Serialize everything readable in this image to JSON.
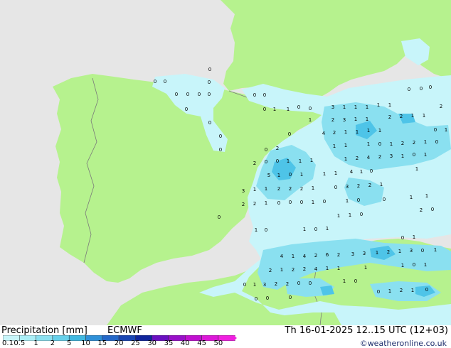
{
  "footer": {
    "title": "Precipitation [mm]",
    "model": "ECMWF",
    "datetime": "Th 16-01-2025 12..15 UTC (12+03)",
    "credit": "©weatheronline.co.uk"
  },
  "legend": {
    "labels": [
      "0.1",
      "0.5",
      "1",
      "2",
      "5",
      "10",
      "15",
      "20",
      "25",
      "30",
      "35",
      "40",
      "45",
      "50"
    ],
    "colors": [
      "#c8f5fa",
      "#aaeef6",
      "#8ae0f0",
      "#66d0ea",
      "#40b8e0",
      "#2f90d8",
      "#2468c8",
      "#1a46b4",
      "#10249c",
      "#6a10c0",
      "#9810c8",
      "#c010d0",
      "#dc18d8",
      "#f020e0"
    ]
  },
  "map": {
    "colors": {
      "land": "#b6f28e",
      "sea": "#e6e6e6",
      "precip_light": "#c8f5fa",
      "precip_mid": "#8ae0f0",
      "precip_heavy": "#4ec4e8",
      "border": "#7a7a7a"
    },
    "values": [
      {
        "id": "v1",
        "t": "0"
      },
      {
        "id": "v2",
        "t": "0"
      },
      {
        "id": "v3",
        "t": "0"
      },
      {
        "id": "v4",
        "t": "0"
      },
      {
        "id": "v5",
        "t": "0"
      },
      {
        "id": "v6",
        "t": "0"
      },
      {
        "id": "v7",
        "t": "0"
      },
      {
        "id": "v8",
        "t": "0"
      },
      {
        "id": "v9",
        "t": "0"
      },
      {
        "id": "v10",
        "t": "0"
      },
      {
        "id": "v11",
        "t": "0"
      },
      {
        "id": "v12",
        "t": "0"
      },
      {
        "id": "v13",
        "t": "0"
      },
      {
        "id": "v14",
        "t": "0"
      },
      {
        "id": "v15",
        "t": "0"
      },
      {
        "id": "v16",
        "t": "1"
      },
      {
        "id": "v17",
        "t": "1"
      },
      {
        "id": "v18",
        "t": "0"
      },
      {
        "id": "v19",
        "t": "0"
      },
      {
        "id": "v20",
        "t": "3"
      },
      {
        "id": "v21",
        "t": "1"
      },
      {
        "id": "v22",
        "t": "1"
      },
      {
        "id": "v23",
        "t": "1"
      },
      {
        "id": "v24",
        "t": "1"
      },
      {
        "id": "v25",
        "t": "1"
      },
      {
        "id": "v26",
        "t": "0"
      },
      {
        "id": "v27",
        "t": "0"
      },
      {
        "id": "v28",
        "t": "0"
      },
      {
        "id": "v29",
        "t": "2"
      },
      {
        "id": "v30",
        "t": "1"
      },
      {
        "id": "v31",
        "t": "2"
      },
      {
        "id": "v32",
        "t": "3"
      },
      {
        "id": "v33",
        "t": "1"
      },
      {
        "id": "v34",
        "t": "1"
      },
      {
        "id": "v35",
        "t": "2"
      },
      {
        "id": "v36",
        "t": "2"
      },
      {
        "id": "v37",
        "t": "1"
      },
      {
        "id": "v38",
        "t": "1"
      },
      {
        "id": "v39",
        "t": "0"
      },
      {
        "id": "v40",
        "t": "1"
      },
      {
        "id": "v41",
        "t": "0"
      },
      {
        "id": "v42",
        "t": "4"
      },
      {
        "id": "v43",
        "t": "2"
      },
      {
        "id": "v44",
        "t": "1"
      },
      {
        "id": "v45",
        "t": "1"
      },
      {
        "id": "v46",
        "t": "1"
      },
      {
        "id": "v47",
        "t": "1"
      },
      {
        "id": "v48",
        "t": "0"
      },
      {
        "id": "v49",
        "t": "2"
      },
      {
        "id": "v50",
        "t": "1"
      },
      {
        "id": "v51",
        "t": "1"
      },
      {
        "id": "v52",
        "t": "1"
      },
      {
        "id": "v53",
        "t": "0"
      },
      {
        "id": "v54",
        "t": "1"
      },
      {
        "id": "v55",
        "t": "2"
      },
      {
        "id": "v56",
        "t": "2"
      },
      {
        "id": "v57",
        "t": "1"
      },
      {
        "id": "v58",
        "t": "0"
      },
      {
        "id": "v59",
        "t": "2"
      },
      {
        "id": "v60",
        "t": "0"
      },
      {
        "id": "v61",
        "t": "0"
      },
      {
        "id": "v62",
        "t": "1"
      },
      {
        "id": "v63",
        "t": "1"
      },
      {
        "id": "v64",
        "t": "1"
      },
      {
        "id": "v65",
        "t": "1"
      },
      {
        "id": "v66",
        "t": "2"
      },
      {
        "id": "v67",
        "t": "4"
      },
      {
        "id": "v68",
        "t": "2"
      },
      {
        "id": "v69",
        "t": "3"
      },
      {
        "id": "v70",
        "t": "1"
      },
      {
        "id": "v71",
        "t": "0"
      },
      {
        "id": "v72",
        "t": "1"
      },
      {
        "id": "v73",
        "t": "5"
      },
      {
        "id": "v74",
        "t": "1"
      },
      {
        "id": "v75",
        "t": "0"
      },
      {
        "id": "v76",
        "t": "1"
      },
      {
        "id": "v77",
        "t": "1"
      },
      {
        "id": "v78",
        "t": "1"
      },
      {
        "id": "v79",
        "t": "4"
      },
      {
        "id": "v80",
        "t": "1"
      },
      {
        "id": "v81",
        "t": "0"
      },
      {
        "id": "v82",
        "t": "1"
      },
      {
        "id": "v83",
        "t": "3"
      },
      {
        "id": "v84",
        "t": "1"
      },
      {
        "id": "v85",
        "t": "1"
      },
      {
        "id": "v86",
        "t": "2"
      },
      {
        "id": "v87",
        "t": "2"
      },
      {
        "id": "v88",
        "t": "2"
      },
      {
        "id": "v89",
        "t": "1"
      },
      {
        "id": "v90",
        "t": "0"
      },
      {
        "id": "v91",
        "t": "3"
      },
      {
        "id": "v92",
        "t": "2"
      },
      {
        "id": "v93",
        "t": "2"
      },
      {
        "id": "v94",
        "t": "1"
      },
      {
        "id": "v95",
        "t": "2"
      },
      {
        "id": "v96",
        "t": "2"
      },
      {
        "id": "v97",
        "t": "1"
      },
      {
        "id": "v98",
        "t": "0"
      },
      {
        "id": "v99",
        "t": "0"
      },
      {
        "id": "v100",
        "t": "0"
      },
      {
        "id": "v101",
        "t": "1"
      },
      {
        "id": "v102",
        "t": "0"
      },
      {
        "id": "v103",
        "t": "1"
      },
      {
        "id": "v104",
        "t": "0"
      },
      {
        "id": "v105",
        "t": "0"
      },
      {
        "id": "v106",
        "t": "1"
      },
      {
        "id": "v107",
        "t": "2"
      },
      {
        "id": "v108",
        "t": "0"
      },
      {
        "id": "v109",
        "t": "1"
      },
      {
        "id": "v110",
        "t": "4"
      },
      {
        "id": "v111",
        "t": "1"
      },
      {
        "id": "v112",
        "t": "4"
      },
      {
        "id": "v113",
        "t": "2"
      },
      {
        "id": "v114",
        "t": "6"
      },
      {
        "id": "v115",
        "t": "2"
      },
      {
        "id": "v116",
        "t": "3"
      },
      {
        "id": "v117",
        "t": "3"
      },
      {
        "id": "v118",
        "t": "1"
      },
      {
        "id": "v119",
        "t": "2"
      },
      {
        "id": "v120",
        "t": "1"
      },
      {
        "id": "v121",
        "t": "3"
      },
      {
        "id": "v122",
        "t": "0"
      },
      {
        "id": "v123",
        "t": "1"
      },
      {
        "id": "v124",
        "t": "2"
      },
      {
        "id": "v125",
        "t": "1"
      },
      {
        "id": "v126",
        "t": "2"
      },
      {
        "id": "v127",
        "t": "2"
      },
      {
        "id": "v128",
        "t": "4"
      },
      {
        "id": "v129",
        "t": "1"
      },
      {
        "id": "v130",
        "t": "1"
      },
      {
        "id": "v131",
        "t": "1"
      },
      {
        "id": "v132",
        "t": "1"
      },
      {
        "id": "v133",
        "t": "0"
      },
      {
        "id": "v134",
        "t": "1"
      },
      {
        "id": "v135",
        "t": "3"
      },
      {
        "id": "v136",
        "t": "2"
      },
      {
        "id": "v137",
        "t": "2"
      },
      {
        "id": "v138",
        "t": "0"
      },
      {
        "id": "v139",
        "t": "0"
      },
      {
        "id": "v140",
        "t": "0"
      },
      {
        "id": "v141",
        "t": "1"
      },
      {
        "id": "v142",
        "t": "1"
      },
      {
        "id": "v143",
        "t": "0"
      },
      {
        "id": "v144",
        "t": "0"
      },
      {
        "id": "v145",
        "t": "1"
      },
      {
        "id": "v146",
        "t": "2"
      },
      {
        "id": "v147",
        "t": "1"
      },
      {
        "id": "v148",
        "t": "0"
      },
      {
        "id": "v149",
        "t": "0"
      },
      {
        "id": "v150",
        "t": "0"
      },
      {
        "id": "v151",
        "t": "0"
      },
      {
        "id": "v152",
        "t": "1"
      },
      {
        "id": "v153",
        "t": "0"
      },
      {
        "id": "v154",
        "t": "1"
      },
      {
        "id": "v155",
        "t": "0"
      },
      {
        "id": "v156",
        "t": "1"
      },
      {
        "id": "v157",
        "t": "1"
      },
      {
        "id": "v158",
        "t": "1"
      },
      {
        "id": "v159",
        "t": "0"
      },
      {
        "id": "v160",
        "t": "0"
      },
      {
        "id": "v161",
        "t": "1"
      },
      {
        "id": "v162",
        "t": "0"
      }
    ]
  }
}
